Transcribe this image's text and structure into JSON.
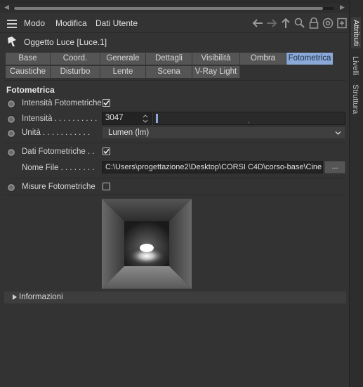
{
  "menubar": {
    "items": [
      "Modo",
      "Modifica",
      "Dati Utente"
    ]
  },
  "object": {
    "title": "Oggetto Luce [Luce.1]"
  },
  "tabs": {
    "row1": [
      {
        "label": "Base",
        "active": false
      },
      {
        "label": "Coord.",
        "active": false
      },
      {
        "label": "Generale",
        "active": false
      },
      {
        "label": "Dettagli",
        "active": false
      },
      {
        "label": "Visibilità",
        "active": false
      },
      {
        "label": "Ombra",
        "active": false
      },
      {
        "label": "Fotometrica",
        "active": true
      }
    ],
    "row2": [
      {
        "label": "Caustiche",
        "active": false
      },
      {
        "label": "Disturbo",
        "active": false
      },
      {
        "label": "Lente",
        "active": false
      },
      {
        "label": "Scena",
        "active": false
      },
      {
        "label": "V-Ray Light",
        "active": false
      }
    ]
  },
  "section": {
    "title": "Fotometrica"
  },
  "fields": {
    "intensita_fotometriche": {
      "label": "Intensità Fotometriche",
      "checked": true
    },
    "intensita": {
      "label": "Intensità . . . . . . . . . .",
      "value": "3047"
    },
    "unita": {
      "label": "Unità . . . . . . . . . . .",
      "value": "Lumen (lm)"
    },
    "dati_fotometriche": {
      "label": "Dati Fotometriche . .",
      "checked": true
    },
    "nome_file": {
      "label": "Nome File . . . . . . . .",
      "value": "C:\\Users\\progettazione2\\Desktop\\CORSI C4D\\corso-base\\Cine",
      "browse": "..."
    },
    "misure_fotometriche": {
      "label": "Misure Fotometriche",
      "checked": false
    }
  },
  "info": {
    "label": "Informazioni"
  },
  "sidebar": {
    "tabs": [
      "Attributi",
      "Livelli",
      "Struttura"
    ]
  },
  "colors": {
    "active_tab": "#8aa9d8",
    "panel_bg": "#333333"
  }
}
